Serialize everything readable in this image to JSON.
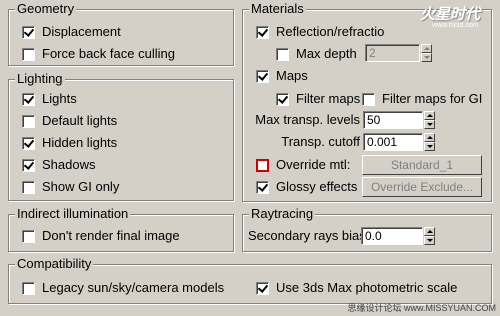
{
  "geometry": {
    "title": "Geometry",
    "displacement": {
      "label": "Displacement",
      "checked": true
    },
    "backface": {
      "label": "Force back face culling",
      "checked": false
    }
  },
  "lighting": {
    "title": "Lighting",
    "lights": {
      "label": "Lights",
      "checked": true
    },
    "default_lights": {
      "label": "Default lights",
      "checked": false
    },
    "hidden_lights": {
      "label": "Hidden lights",
      "checked": true
    },
    "shadows": {
      "label": "Shadows",
      "checked": true
    },
    "show_gi_only": {
      "label": "Show GI only",
      "checked": false
    }
  },
  "indirect": {
    "title": "Indirect illumination",
    "dont_render": {
      "label": "Don't render final image",
      "checked": false
    }
  },
  "materials": {
    "title": "Materials",
    "reflection": {
      "label": "Reflection/refractio",
      "checked": true
    },
    "max_depth": {
      "label": "Max depth",
      "checked": false,
      "value": "2"
    },
    "maps": {
      "label": "Maps",
      "checked": true
    },
    "filter_maps": {
      "label": "Filter maps",
      "checked": true
    },
    "filter_maps_gi": {
      "label": "Filter maps for GI",
      "checked": false
    },
    "max_transp_levels": {
      "label": "Max transp. levels",
      "value": "50"
    },
    "transp_cutoff": {
      "label": "Transp. cutoff",
      "value": "0.001"
    },
    "override_mtl": {
      "label": "Override mtl:",
      "checked": false,
      "button": "Standard_1"
    },
    "glossy": {
      "label": "Glossy effects",
      "checked": true,
      "button": "Override Exclude..."
    }
  },
  "raytracing": {
    "title": "Raytracing",
    "secondary_bias": {
      "label": "Secondary rays bias",
      "value": "0.0"
    }
  },
  "compatibility": {
    "title": "Compatibility",
    "legacy": {
      "label": "Legacy sun/sky/camera models",
      "checked": false
    },
    "photometric": {
      "label": "Use 3ds Max photometric scale",
      "checked": true
    }
  },
  "watermark": {
    "logo": "火星时代",
    "logo_sub": "www.hxsd.com",
    "footer": "思缘设计论坛 www.MISSYUAN.COM"
  },
  "colors": {
    "background": "#d4d0c8",
    "highlight": "#d00000"
  }
}
